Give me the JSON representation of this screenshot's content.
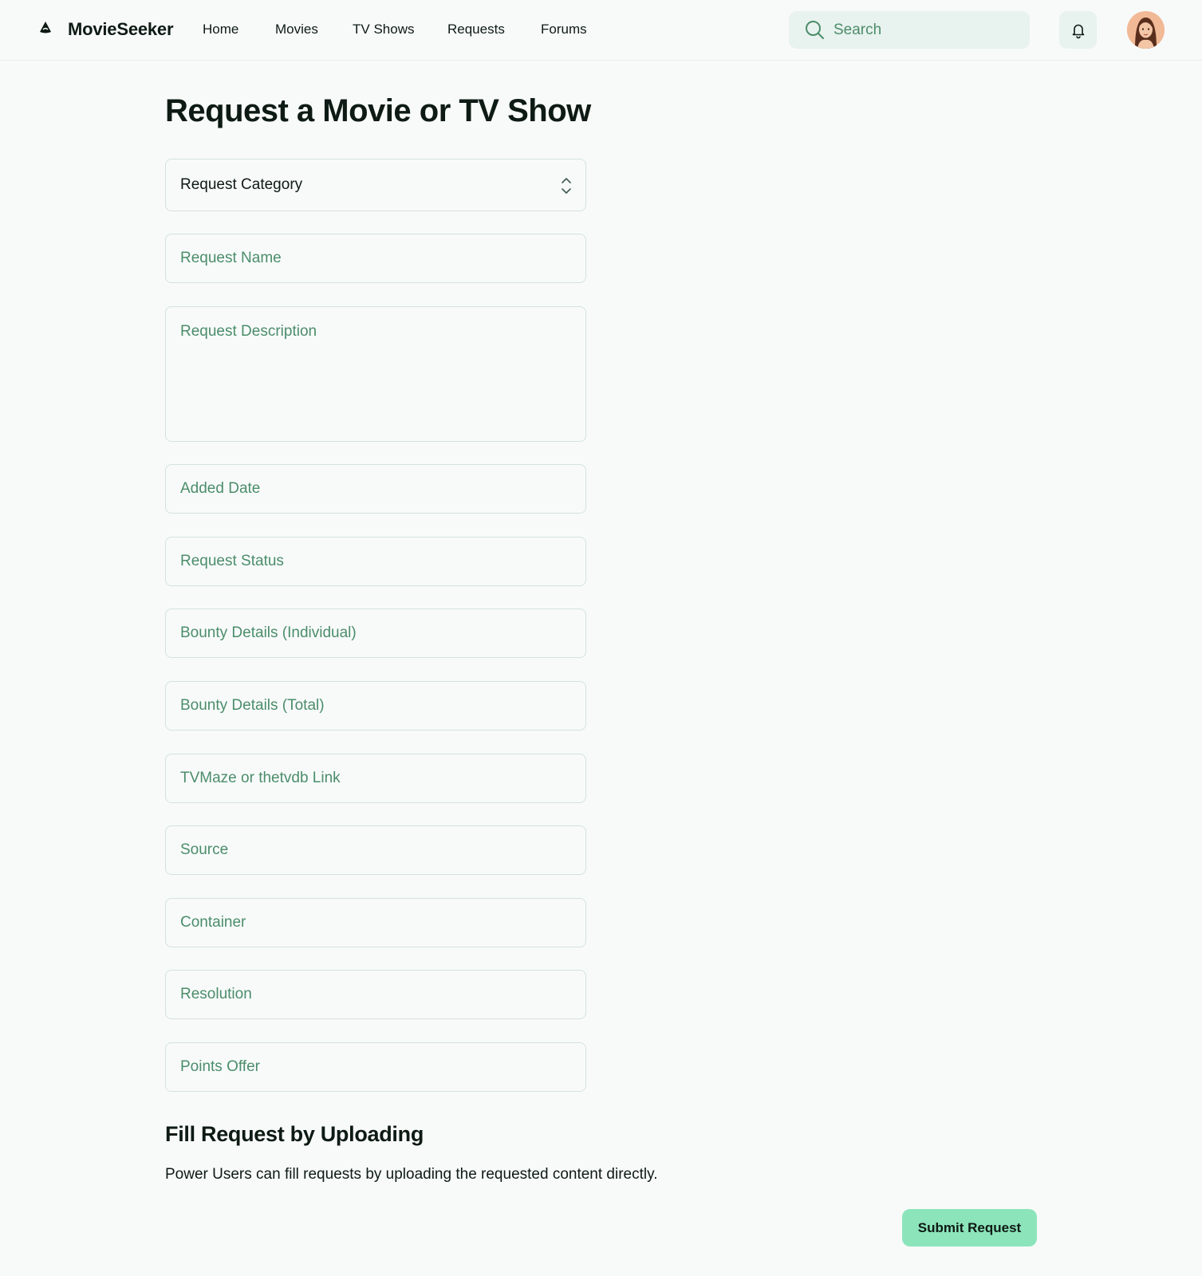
{
  "app": {
    "brand": "MovieSeeker",
    "icons": {
      "logo": "movieseeker-logo-icon",
      "search": "search-icon",
      "notifications": "bell-icon",
      "avatar": "user-avatar"
    }
  },
  "nav": {
    "items": [
      "Home",
      "Movies",
      "TV Shows",
      "Requests",
      "Forums"
    ]
  },
  "search": {
    "placeholder": "Search"
  },
  "page": {
    "title": "Request a Movie or TV Show"
  },
  "form": {
    "category": {
      "value": "Request Category"
    },
    "fields": [
      {
        "placeholder": "Request Name"
      },
      {
        "placeholder": "Request Description"
      },
      {
        "placeholder": "Added Date"
      },
      {
        "placeholder": "Request Status"
      },
      {
        "placeholder": "Bounty Details (Individual)"
      },
      {
        "placeholder": "Bounty Details (Total)"
      },
      {
        "placeholder": "TVMaze or thetvdb Link"
      },
      {
        "placeholder": "Source"
      },
      {
        "placeholder": "Container"
      },
      {
        "placeholder": "Resolution"
      },
      {
        "placeholder": "Points Offer"
      }
    ]
  },
  "upload_section": {
    "title": "Fill Request by Uploading",
    "text": "Power Users can fill requests by uploading the requested content directly."
  },
  "actions": {
    "submit_label": "Submit Request"
  },
  "colors": {
    "background": "#f8fafa",
    "accent": "#8ce4bb",
    "placeholder": "#4b8d6a",
    "search_bg": "#e8f2ee",
    "border": "#d3e3dc"
  }
}
